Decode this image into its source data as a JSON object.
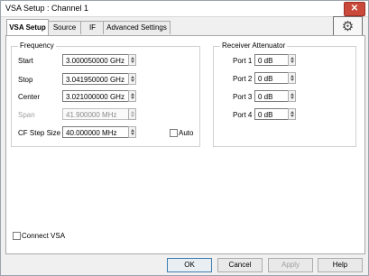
{
  "window": {
    "title": "VSA Setup : Channel 1",
    "close_glyph": "✕"
  },
  "tabs": [
    {
      "label": "VSA Setup"
    },
    {
      "label": "Source"
    },
    {
      "label": "IF"
    },
    {
      "label": "Advanced Settings"
    }
  ],
  "settings_button": {
    "icon": "gear-icon",
    "glyph": "⚙"
  },
  "frequency": {
    "title": "Frequency",
    "start": {
      "label": "Start",
      "value": "3.000050000 GHz"
    },
    "stop": {
      "label": "Stop",
      "value": "3.041950000 GHz"
    },
    "center": {
      "label": "Center",
      "value": "3.021000000 GHz"
    },
    "span": {
      "label": "Span",
      "value": "41.900000 MHz"
    },
    "step": {
      "label": "CF Step Size",
      "value": "40.000000 MHz"
    },
    "auto_label": "Auto"
  },
  "receiver": {
    "title": "Receiver Attenuator",
    "ports": [
      {
        "label": "Port 1",
        "value": "0 dB"
      },
      {
        "label": "Port 2",
        "value": "0 dB"
      },
      {
        "label": "Port 3",
        "value": "0 dB"
      },
      {
        "label": "Port 4",
        "value": "0 dB"
      }
    ]
  },
  "connect_vsa": {
    "label": "Connect VSA"
  },
  "buttons": {
    "ok": "OK",
    "cancel": "Cancel",
    "apply": "Apply",
    "help": "Help"
  }
}
